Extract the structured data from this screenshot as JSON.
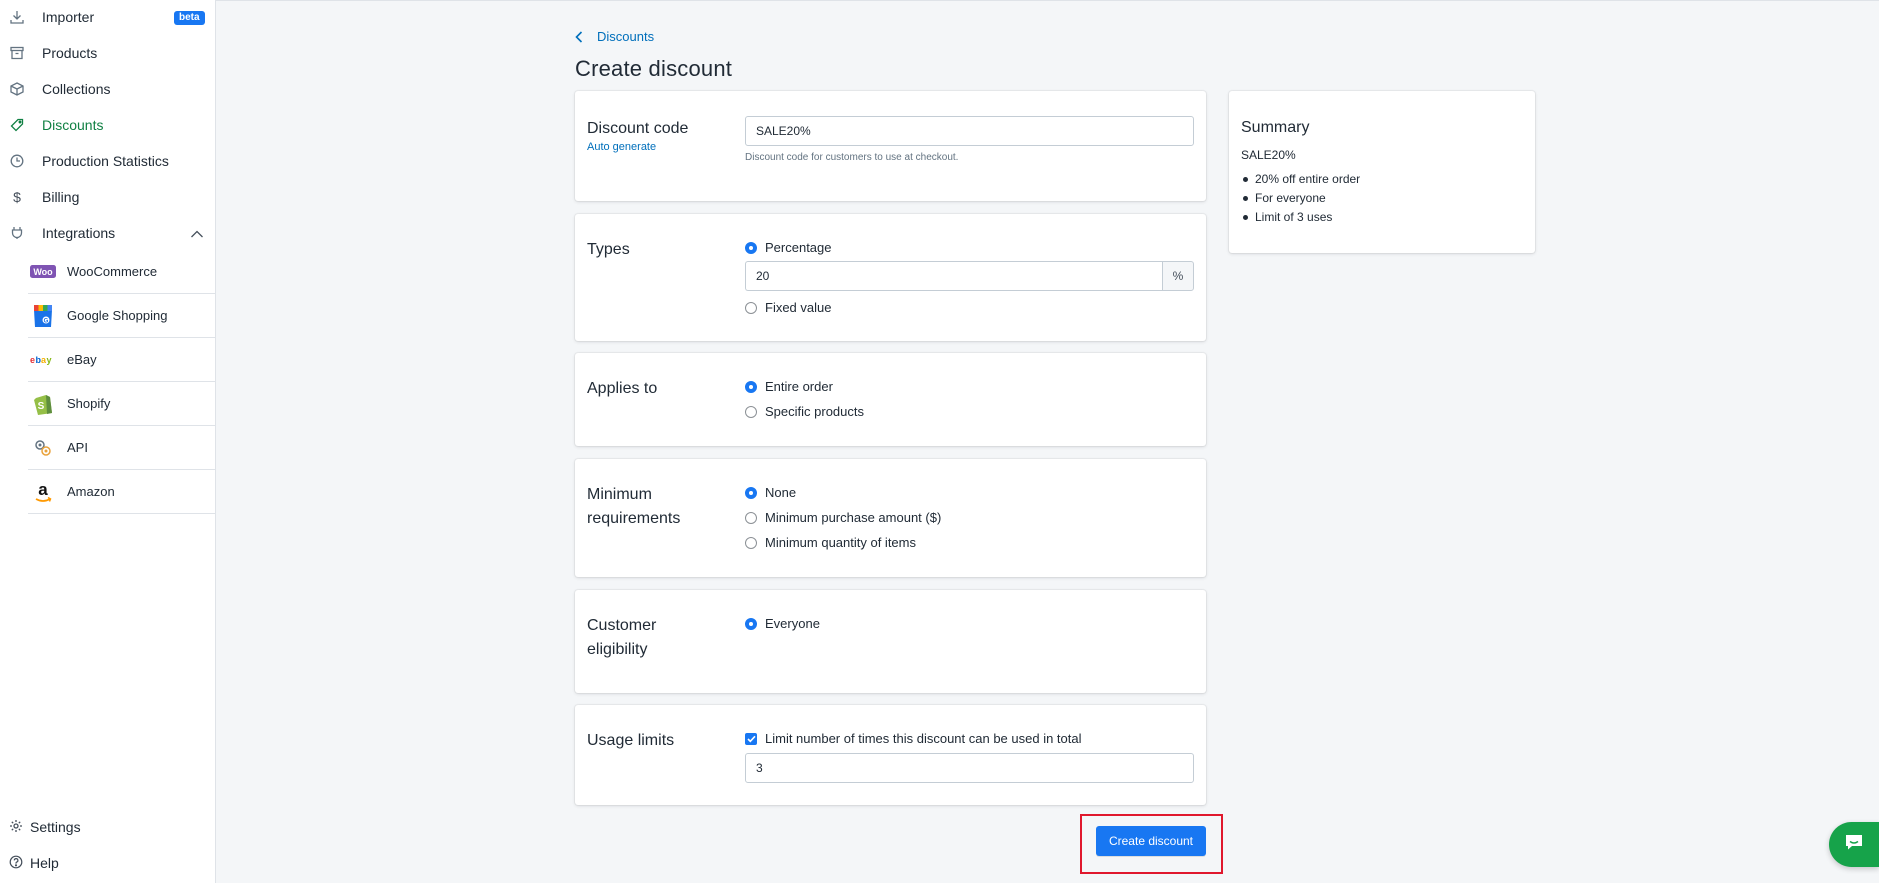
{
  "sidebar": {
    "items": [
      {
        "label": "Importer",
        "icon": "download-icon",
        "badge": "beta"
      },
      {
        "label": "Products",
        "icon": "archive-icon"
      },
      {
        "label": "Collections",
        "icon": "box-icon"
      },
      {
        "label": "Discounts",
        "icon": "tag-icon"
      },
      {
        "label": "Production Statistics",
        "icon": "clock-icon"
      },
      {
        "label": "Billing",
        "icon": "dollar-icon"
      },
      {
        "label": "Integrations",
        "icon": "plug-icon"
      }
    ],
    "integrations": [
      {
        "label": "WooCommerce",
        "logo": "woocommerce-logo"
      },
      {
        "label": "Google Shopping",
        "logo": "google-shopping-logo"
      },
      {
        "label": "eBay",
        "logo": "ebay-logo"
      },
      {
        "label": "Shopify",
        "logo": "shopify-logo"
      },
      {
        "label": "API",
        "logo": "api-icon"
      },
      {
        "label": "Amazon",
        "logo": "amazon-logo"
      }
    ],
    "bottom": [
      {
        "label": "Settings",
        "icon": "gear-icon"
      },
      {
        "label": "Help",
        "icon": "help-icon"
      }
    ]
  },
  "breadcrumb": {
    "label": "Discounts"
  },
  "page": {
    "title": "Create discount"
  },
  "discount_code": {
    "label": "Discount code",
    "auto_generate": "Auto generate",
    "value": "SALE20%",
    "help": "Discount code for customers to use at checkout."
  },
  "types": {
    "label": "Types",
    "percentage": "Percentage",
    "percentage_value": "20",
    "suffix": "%",
    "fixed": "Fixed value",
    "selected": "percentage"
  },
  "applies_to": {
    "label": "Applies to",
    "entire_order": "Entire order",
    "specific_products": "Specific products",
    "selected": "entire_order"
  },
  "minimum": {
    "label_line1": "Minimum",
    "label_line2": "requirements",
    "none": "None",
    "purchase_amount": "Minimum purchase amount ($)",
    "quantity": "Minimum quantity of items",
    "selected": "none"
  },
  "eligibility": {
    "label_line1": "Customer",
    "label_line2": "eligibility",
    "everyone": "Everyone",
    "selected": "everyone"
  },
  "usage": {
    "label": "Usage limits",
    "limit_label": "Limit number of times this discount can be used in total",
    "limit_checked": true,
    "limit_value": "3"
  },
  "summary": {
    "title": "Summary",
    "code": "SALE20%",
    "items": [
      "20% off entire order",
      "For everyone",
      "Limit of 3 uses"
    ]
  },
  "actions": {
    "create": "Create discount"
  },
  "colors": {
    "accent": "#1877f2",
    "active_nav": "#108043",
    "highlight": "#e0182d",
    "chat": "#16a34a"
  }
}
